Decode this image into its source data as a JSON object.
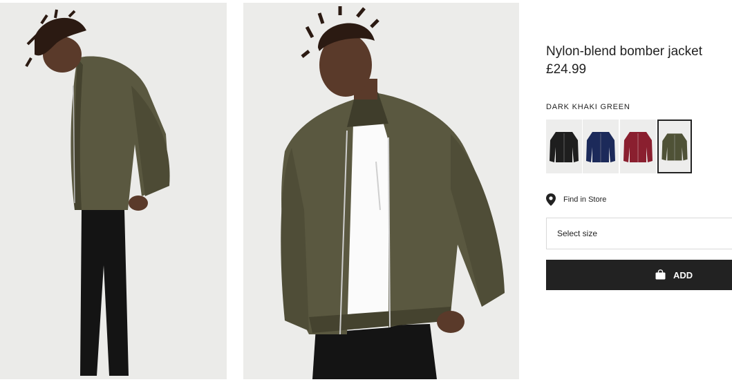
{
  "product": {
    "title": "Nylon-blend bomber jacket",
    "price": "£24.99",
    "color_name": "DARK KHAKI GREEN"
  },
  "swatches": [
    {
      "name": "black",
      "color": "#1e1e1e",
      "selected": false
    },
    {
      "name": "navy",
      "color": "#1c2a5a",
      "selected": false
    },
    {
      "name": "burgundy",
      "color": "#8a1f2f",
      "selected": false
    },
    {
      "name": "dark-khaki-green",
      "color": "#4f5236",
      "selected": true
    }
  ],
  "actions": {
    "find_in_store": "Find in Store",
    "size_placeholder": "Select size",
    "add_label": "ADD"
  },
  "colors": {
    "jacket": "#5a5840",
    "jacket_shadow": "#45432f",
    "trousers": "#141414",
    "skin": "#5a3a2a",
    "button": "#222222"
  },
  "icons": {
    "store": "map-pin-icon",
    "bag": "shopping-bag-icon"
  }
}
